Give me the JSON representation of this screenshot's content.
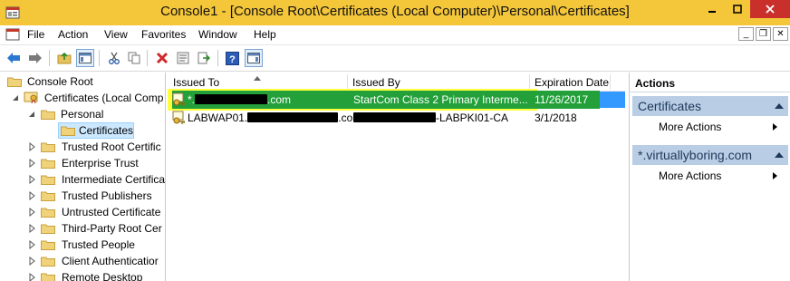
{
  "window": {
    "title": "Console1 - [Console Root\\Certificates (Local Computer)\\Personal\\Certificates]"
  },
  "menu": [
    "File",
    "Action",
    "View",
    "Favorites",
    "Window",
    "Help"
  ],
  "tree": {
    "root": "Console Root",
    "store": "Certificates (Local Comp",
    "personal": "Personal",
    "certificates": "Certificates",
    "items": [
      "Trusted Root Certific",
      "Enterprise Trust",
      "Intermediate Certifica",
      "Trusted Publishers",
      "Untrusted Certificate",
      "Third-Party Root Cer",
      "Trusted People",
      "Client Authenticatior",
      "Remote Desktop"
    ]
  },
  "columns": {
    "issued_to": "Issued To",
    "issued_by": "Issued By",
    "expiration": "Expiration Date"
  },
  "rows": [
    {
      "issued_to_prefix": "*.",
      "issued_to_suffix": ".com",
      "issued_by_prefix": "",
      "issued_by": "StartCom Class 2 Primary Interme...",
      "expiration": "11/26/2017"
    },
    {
      "issued_to_prefix": "LABWAP01.",
      "issued_to_suffix": ".com",
      "issued_by_prefix": "",
      "issued_by": "-LABPKI01-CA",
      "expiration": "3/1/2018"
    }
  ],
  "actions": {
    "header": "Actions",
    "group1": "Certificates",
    "group1_more": "More Actions",
    "group2": "*.virtuallyboring.com",
    "group2_more": "More Actions"
  },
  "colors": {
    "titlebar": "#f4c63a",
    "close": "#c9302c",
    "selection": "#3399ff",
    "highlight_green": "#23a03a",
    "highlight_yellow": "#ffff3c",
    "action_group": "#b9cde5"
  }
}
